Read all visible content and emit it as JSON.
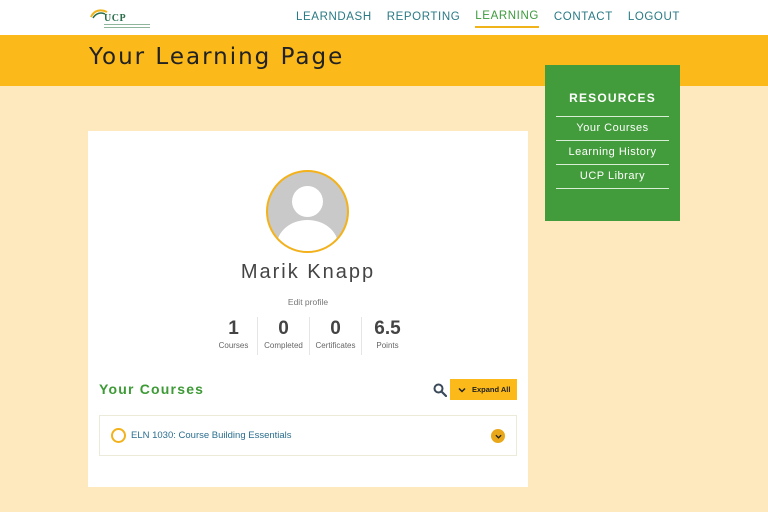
{
  "header": {
    "logo_text": "UCP",
    "nav": [
      {
        "label": "LEARNDASH",
        "active": false
      },
      {
        "label": "REPORTING",
        "active": false
      },
      {
        "label": "LEARNING",
        "active": true
      },
      {
        "label": "CONTACT",
        "active": false
      },
      {
        "label": "LOGOUT",
        "active": false
      }
    ]
  },
  "banner": {
    "title": "Your Learning Page"
  },
  "resources": {
    "title": "RESOURCES",
    "links": [
      "Your Courses",
      "Learning History",
      "UCP Library"
    ]
  },
  "profile": {
    "name": "Marik Knapp",
    "edit_label": "Edit profile",
    "stats": [
      {
        "value": "1",
        "label": "Courses"
      },
      {
        "value": "0",
        "label": "Completed"
      },
      {
        "value": "0",
        "label": "Certificates"
      },
      {
        "value": "6.5",
        "label": "Points"
      }
    ]
  },
  "courses": {
    "title": "Your Courses",
    "search_icon": "search-icon",
    "expand_label": "Expand All",
    "items": [
      {
        "name": "ELN 1030: Course Building Essentials"
      }
    ]
  },
  "colors": {
    "accent_yellow": "#fbb91a",
    "page_bg": "#fde9bd",
    "green": "#439c3b",
    "nav_teal": "#2a7a85"
  }
}
